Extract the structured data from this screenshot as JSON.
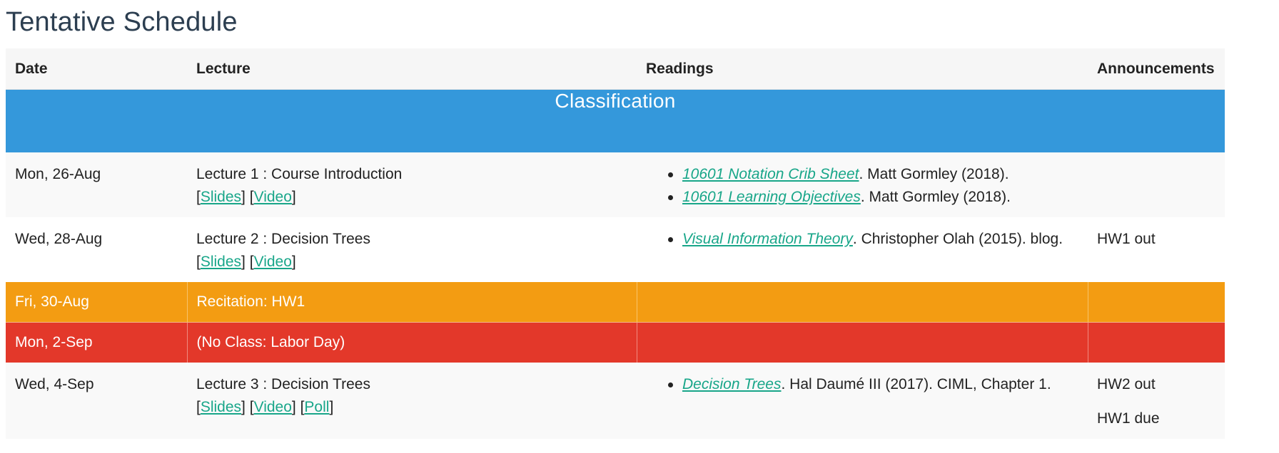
{
  "page": {
    "title": "Tentative Schedule"
  },
  "table": {
    "headers": {
      "date": "Date",
      "lecture": "Lecture",
      "readings": "Readings",
      "announcements": "Announcements"
    },
    "section": "Classification",
    "rows": [
      {
        "date": "Mon, 26-Aug",
        "lecture": "Lecture 1 : Course Introduction",
        "links": [
          "Slides",
          "Video"
        ],
        "readings": [
          {
            "link": "10601 Notation Crib Sheet",
            "rest": ". Matt Gormley (2018)."
          },
          {
            "link": "10601 Learning Objectives",
            "rest": ". Matt Gormley (2018)."
          }
        ],
        "announcements": []
      },
      {
        "date": "Wed, 28-Aug",
        "lecture": "Lecture 2 : Decision Trees",
        "links": [
          "Slides",
          "Video"
        ],
        "readings": [
          {
            "link": "Visual Information Theory",
            "rest": ". Christopher Olah (2015). blog."
          }
        ],
        "announcements": [
          "HW1 out"
        ]
      },
      {
        "date": "Fri, 30-Aug",
        "lecture": "Recitation: HW1",
        "type": "recitation"
      },
      {
        "date": "Mon, 2-Sep",
        "lecture": "(No Class: Labor Day)",
        "type": "holiday"
      },
      {
        "date": "Wed, 4-Sep",
        "lecture": "Lecture 3 : Decision Trees",
        "links": [
          "Slides",
          "Video",
          "Poll"
        ],
        "readings": [
          {
            "link": "Decision Trees",
            "rest": ". Hal Daumé III (2017). CIML, Chapter 1."
          }
        ],
        "announcements": [
          "HW2 out",
          "HW1 due"
        ]
      }
    ]
  },
  "colors": {
    "section_header": "#3498db",
    "recitation": "#f39c12",
    "holiday": "#e3382a",
    "link": "#18a689",
    "title": "#2c3e50"
  }
}
